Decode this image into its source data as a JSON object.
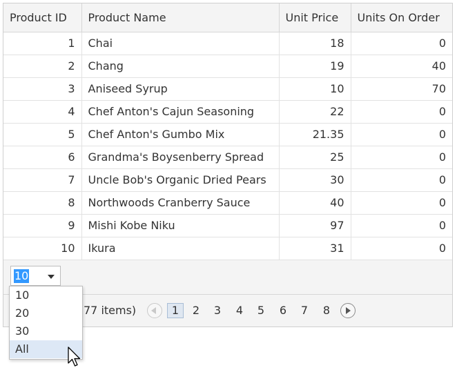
{
  "columns": [
    "Product ID",
    "Product Name",
    "Unit Price",
    "Units On Order"
  ],
  "rows": [
    {
      "id": "1",
      "name": "Chai",
      "price": "18",
      "order": "0"
    },
    {
      "id": "2",
      "name": "Chang",
      "price": "19",
      "order": "40"
    },
    {
      "id": "3",
      "name": "Aniseed Syrup",
      "price": "10",
      "order": "70"
    },
    {
      "id": "4",
      "name": "Chef Anton's Cajun Seasoning",
      "price": "22",
      "order": "0"
    },
    {
      "id": "5",
      "name": "Chef Anton's Gumbo Mix",
      "price": "21.35",
      "order": "0"
    },
    {
      "id": "6",
      "name": "Grandma's Boysenberry Spread",
      "price": "25",
      "order": "0"
    },
    {
      "id": "7",
      "name": "Uncle Bob's Organic Dried Pears",
      "price": "30",
      "order": "0"
    },
    {
      "id": "8",
      "name": "Northwoods Cranberry Sauce",
      "price": "40",
      "order": "0"
    },
    {
      "id": "9",
      "name": "Mishi Kobe Niku",
      "price": "97",
      "order": "0"
    },
    {
      "id": "10",
      "name": "Ikura",
      "price": "31",
      "order": "0"
    }
  ],
  "pager": {
    "page_size_value": "10",
    "page_size_options": [
      "10",
      "20",
      "30",
      "All"
    ],
    "hovered_option": "All",
    "items_text": "77 items)",
    "pages": [
      "1",
      "2",
      "3",
      "4",
      "5",
      "6",
      "7",
      "8"
    ],
    "current_page": "1"
  },
  "colors": {
    "selection": "#3399ff",
    "header_bg": "#f4f4f4",
    "active_page_bg": "#dfe7f1",
    "hover_option_bg": "#dde8f6"
  },
  "icons": {
    "prev": "circle-left-arrow-icon",
    "next": "circle-right-arrow-icon",
    "dropdown": "caret-down-icon",
    "cursor": "mouse-pointer-icon"
  }
}
